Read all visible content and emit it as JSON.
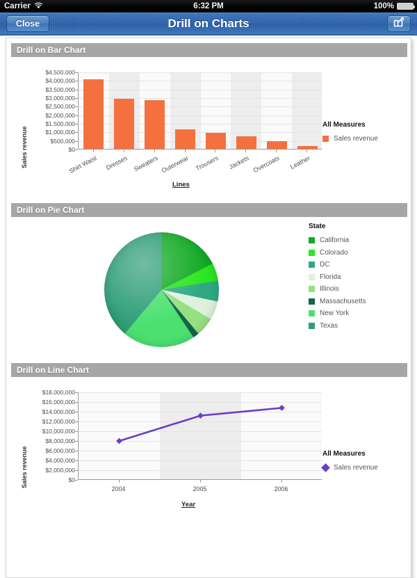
{
  "status_bar": {
    "carrier": "Carrier",
    "wifi_icon": "wifi-icon",
    "time": "6:32 PM",
    "battery_percent": "100%",
    "battery_icon": "battery-full-icon"
  },
  "nav_bar": {
    "close_label": "Close",
    "title": "Drill on Charts",
    "share_icon": "share-action-icon"
  },
  "sections": [
    {
      "title": "Drill on Bar Chart"
    },
    {
      "title": "Drill on Pie Chart"
    },
    {
      "title": "Drill on Line Chart"
    }
  ],
  "chart_data": [
    {
      "type": "bar",
      "title": "Drill on Bar Chart",
      "xlabel": "Lines",
      "ylabel": "Sales revenue",
      "categories": [
        "Shirt Waist",
        "Dresses",
        "Sweaters",
        "Outerwear",
        "Trousers",
        "Jackets",
        "Overcoats",
        "Leather"
      ],
      "values": [
        4050000,
        2930000,
        2850000,
        1130000,
        950000,
        720000,
        430000,
        170000
      ],
      "ylim": [
        0,
        4500000
      ],
      "yticks": [
        "$0",
        "$500,000",
        "$1,000,000",
        "$1,500,000",
        "$2,000,000",
        "$2,500,000",
        "$3,000,000",
        "$3,500,000",
        "$4,000,000",
        "$4,500,000"
      ],
      "ytick_values": [
        0,
        500000,
        1000000,
        1500000,
        2000000,
        2500000,
        3000000,
        3500000,
        4000000,
        4500000
      ],
      "grid": true,
      "legend": {
        "title": "All Measures",
        "position": "right",
        "entries": [
          {
            "name": "Sales revenue",
            "color": "#f4713f"
          }
        ]
      },
      "series_color": "#f4713f"
    },
    {
      "type": "pie",
      "title": "Drill on Pie Chart",
      "legend": {
        "title": "State",
        "position": "right"
      },
      "slices": [
        {
          "label": "California",
          "percent": 17.5,
          "color": "#13aa26"
        },
        {
          "label": "Colorado",
          "percent": 5.0,
          "color": "#2de520"
        },
        {
          "label": "DC",
          "percent": 5.8,
          "color": "#2fa981"
        },
        {
          "label": "Florida",
          "percent": 5.3,
          "color": "#dff1dc"
        },
        {
          "label": "Illinois",
          "percent": 5.3,
          "color": "#95e083"
        },
        {
          "label": "Massachusetts",
          "percent": 1.7,
          "color": "#15644a"
        },
        {
          "label": "New York",
          "percent": 20.5,
          "color": "#4ce070"
        },
        {
          "label": "Texas",
          "percent": 38.9,
          "color": "#2f9e77"
        }
      ]
    },
    {
      "type": "line",
      "title": "Drill on Line Chart",
      "xlabel": "Year",
      "ylabel": "Sales revenue",
      "x": [
        "2004",
        "2005",
        "2006"
      ],
      "values": [
        8000000,
        13200000,
        14800000
      ],
      "ylim": [
        0,
        18000000
      ],
      "yticks": [
        "$0",
        "$2,000,000",
        "$4,000,000",
        "$6,000,000",
        "$8,000,000",
        "$10,000,000",
        "$12,000,000",
        "$14,000,000",
        "$16,000,000",
        "$18,000,000"
      ],
      "ytick_values": [
        0,
        2000000,
        4000000,
        6000000,
        8000000,
        10000000,
        12000000,
        14000000,
        16000000,
        18000000
      ],
      "grid": true,
      "legend": {
        "title": "All Measures",
        "position": "right",
        "entries": [
          {
            "name": "Sales revenue",
            "color": "#6b3fc6"
          }
        ]
      },
      "series_color": "#6b3fc6"
    }
  ]
}
